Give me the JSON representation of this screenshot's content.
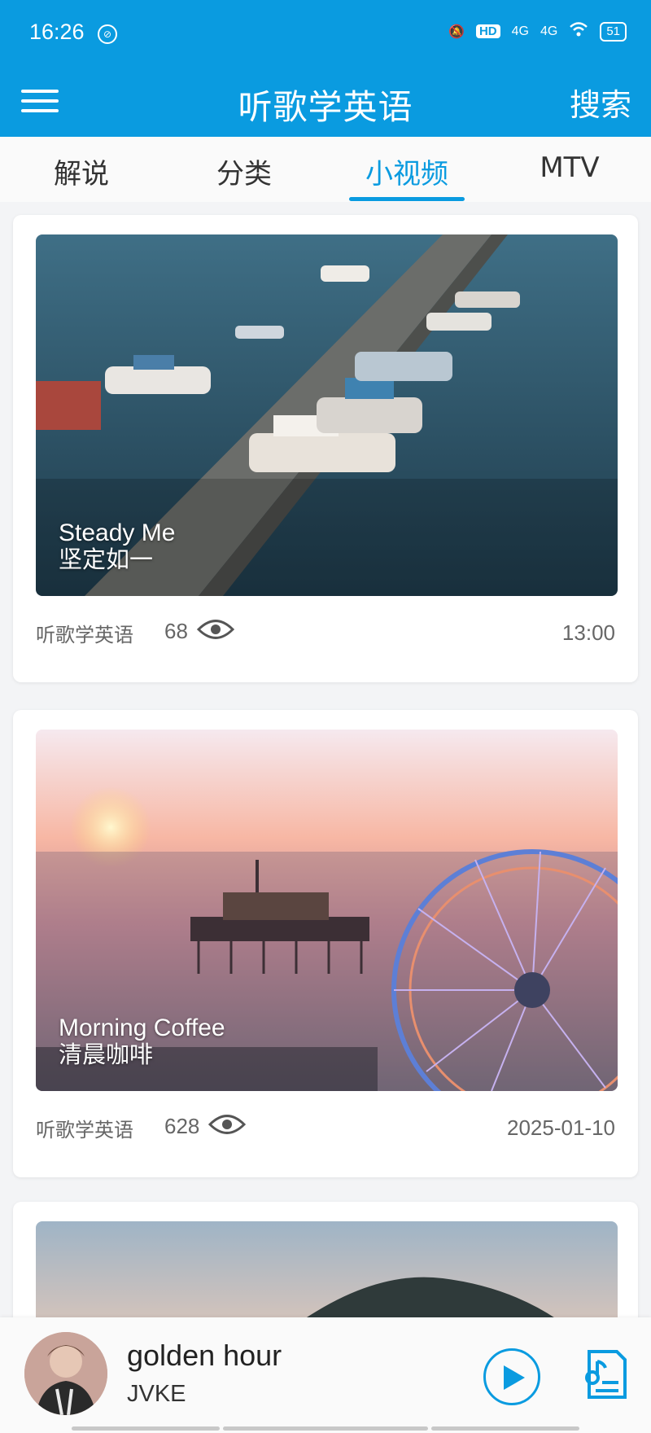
{
  "status_bar": {
    "time": "16:26",
    "network_1": "4G",
    "network_2": "4G",
    "hd_badge": "HD",
    "battery": "51"
  },
  "header": {
    "title": "听歌学英语",
    "search_label": "搜索"
  },
  "tabs": [
    {
      "label": "解说",
      "active": false
    },
    {
      "label": "分类",
      "active": false
    },
    {
      "label": "小视频",
      "active": true
    },
    {
      "label": "MTV",
      "active": false
    }
  ],
  "videos": [
    {
      "title_en": "Steady Me",
      "title_zh": "坚定如一",
      "author": "听歌学英语",
      "views": "68",
      "date": "13:00"
    },
    {
      "title_en": "Morning Coffee",
      "title_zh": "清晨咖啡",
      "author": "听歌学英语",
      "views": "628",
      "date": "2025-01-10"
    }
  ],
  "player": {
    "song": "golden hour",
    "artist": "JVKE"
  },
  "colors": {
    "primary": "#0a9be0",
    "background": "#f3f4f6"
  }
}
